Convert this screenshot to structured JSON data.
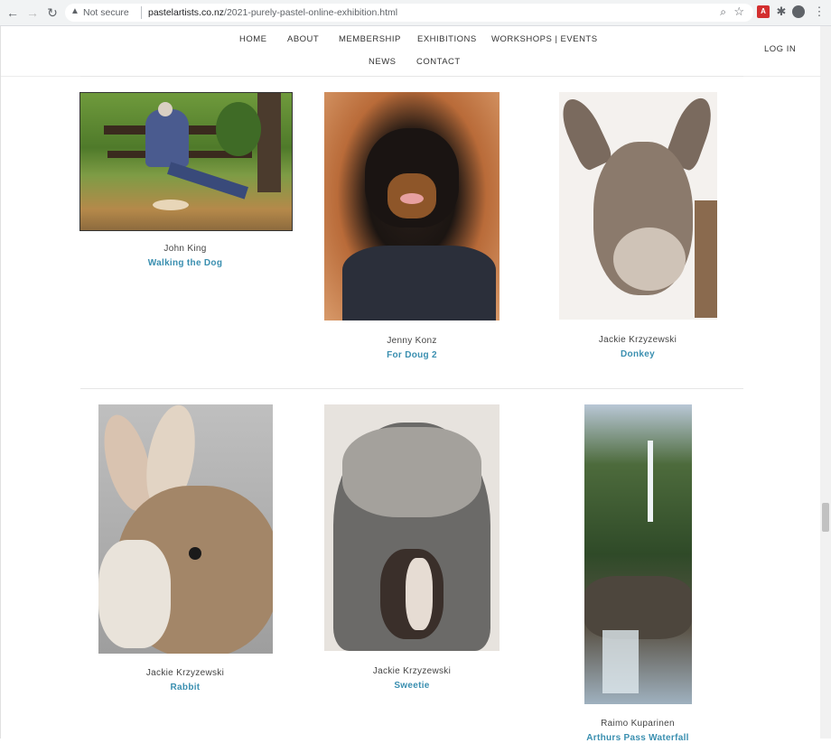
{
  "browser": {
    "security_label": "Not secure",
    "url_host": "pastelartists.co.nz",
    "url_path": "/2021-purely-pastel-online-exhibition.html",
    "icons": [
      "back-icon",
      "forward-icon",
      "reload-icon",
      "warning-icon",
      "zoom-icon",
      "star-icon",
      "pdf-extension-icon",
      "puzzle-icon",
      "profile-icon",
      "menu-icon"
    ]
  },
  "nav": {
    "home": "HOME",
    "about": "ABOUT",
    "membership": "MEMBERSHIP",
    "exhibitions": "EXHIBITIONS",
    "workshops": "WORKSHOPS | EVENTS",
    "news": "NEWS",
    "contact": "CONTACT",
    "login": "LOG IN"
  },
  "gallery": [
    {
      "artist": "John King",
      "title": "Walking the Dog"
    },
    {
      "artist": "Jenny Konz",
      "title": "For Doug 2"
    },
    {
      "artist": "Jackie Krzyzewski",
      "title": "Donkey"
    },
    {
      "artist": "Jackie Krzyzewski",
      "title": "Rabbit"
    },
    {
      "artist": "Jackie Krzyzewski",
      "title": "Sweetie"
    },
    {
      "artist": "Raimo Kuparinen",
      "title": "Arthurs Pass Waterfall"
    }
  ],
  "colors": {
    "accent": "#3a8fb0",
    "text": "#333333"
  }
}
